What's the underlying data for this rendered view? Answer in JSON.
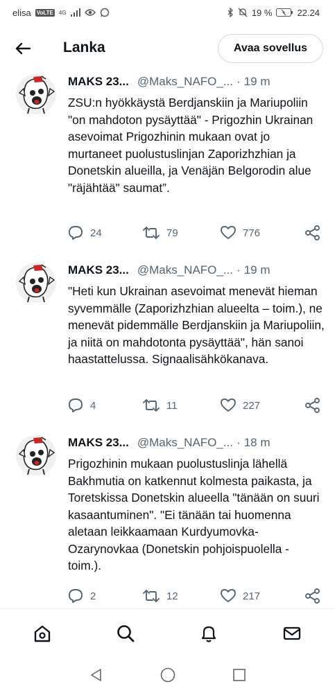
{
  "status_bar": {
    "carrier": "elisa",
    "volte": "VoLTE",
    "network": "4G",
    "battery": "19 %",
    "time": "22.24"
  },
  "header": {
    "title": "Lanka",
    "open_app_label": "Avaa sovellus"
  },
  "tweets": [
    {
      "name": "MAKS 23...",
      "handle": "@Maks_NAFO_...",
      "separator": "·",
      "time": "19 m",
      "text": "ZSU:n hyökkäystä Berdjanskiin ja Mariupoliin \"on mahdoton pysäyttää\" - Prigozhin Ukrainan asevoimat Prigozhinin mukaan ovat jo murtaneet puolustuslinjan Zaporizhzhian ja Donetskin alueilla, ja Venäjän Belgorodin alue \"räjähtää\" saumat”.",
      "replies": "24",
      "retweets": "79",
      "likes": "776"
    },
    {
      "name": "MAKS 23...",
      "handle": "@Maks_NAFO_...",
      "separator": "·",
      "time": "19 m",
      "text": "\"Heti kun Ukrainan asevoimat menevät hieman syvemmälle (Zaporizhzhian alueelta – toim.), ne menevät pidemmälle Berdjanskiin ja Mariupoliin, ja niitä on mahdotonta pysäyttää\", hän sanoi haastattelussa. Signaalisähkökanava.",
      "replies": "4",
      "retweets": "11",
      "likes": "227"
    },
    {
      "name": "MAKS 23...",
      "handle": "@Maks_NAFO_...",
      "separator": "·",
      "time": "18 m",
      "text": "Prigozhinin mukaan puolustuslinja lähellä Bakhmutia on katkennut kolmesta paikasta, ja Toretskissa Donetskin alueella \"tänään on suuri kasaantuminen\". \"Ei tänään tai huomenna aletaan leikkaamaan Kurdyumovka-Ozarynovkaa (Donetskin pohjoispuolella - toim.).",
      "replies": "2",
      "retweets": "12",
      "likes": "217"
    }
  ],
  "bottom_nav": [
    "home-icon",
    "search-icon",
    "notifications-icon",
    "messages-icon"
  ],
  "system_nav": [
    "back-triangle-icon",
    "home-circle-icon",
    "recents-square-icon"
  ],
  "colors": {
    "text": "#0f1419",
    "secondary": "#536471",
    "border": "#cfd9de"
  }
}
